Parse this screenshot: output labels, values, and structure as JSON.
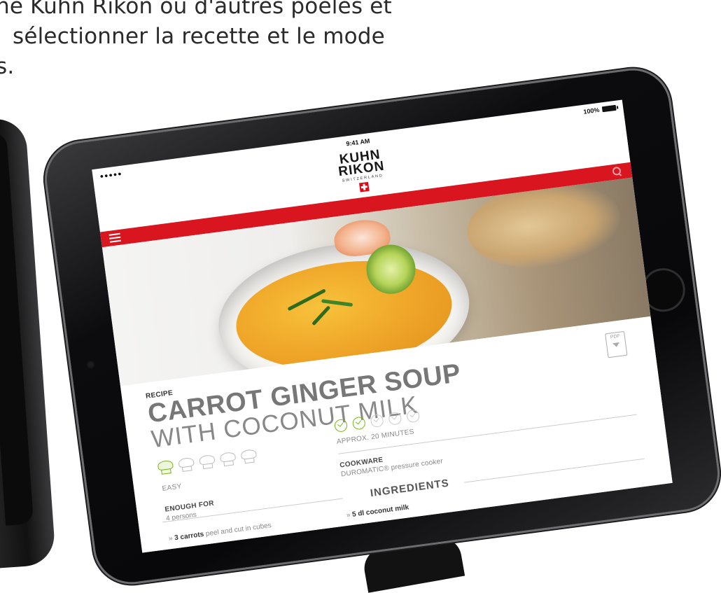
{
  "background_text": {
    "line1": "ne Kuhn Rikon ou d'autres poêles et",
    "line2": "sélectionner la recette et le mode",
    "line3": "s."
  },
  "status_bar": {
    "signal": "●●●●● ",
    "time": "9:41 AM",
    "battery": "100%"
  },
  "header": {
    "logo_line1": "KUHN",
    "logo_line2": "RIKON",
    "logo_sub": "SWITZERLAND"
  },
  "recipe": {
    "label": "RECIPE",
    "title_line1": "CARROT GINGER SOUP",
    "title_line2": "WITH COCONUT MILK",
    "pdf_label": "PDF",
    "difficulty": {
      "label": "EASY",
      "level": 1,
      "max": 5
    },
    "time": {
      "label": "APPROX. 20 MINUTES",
      "level": 2,
      "max": 5
    },
    "servings": {
      "label": "ENOUGH FOR",
      "value": "4 persons"
    },
    "cookware": {
      "label": "COOKWARE",
      "value": "DUROMATIC® pressure cooker"
    },
    "ingredients": {
      "title": "INGREDIENTS",
      "items": [
        {
          "prefix": "» ",
          "name": "3 carrots",
          "detail": " peel and cut in cubes"
        },
        {
          "prefix": "» ",
          "name": "5 dl coconut milk",
          "detail": ""
        }
      ]
    }
  },
  "colors": {
    "brand_red": "#d9151f",
    "accent_green": "#7ab51d"
  }
}
